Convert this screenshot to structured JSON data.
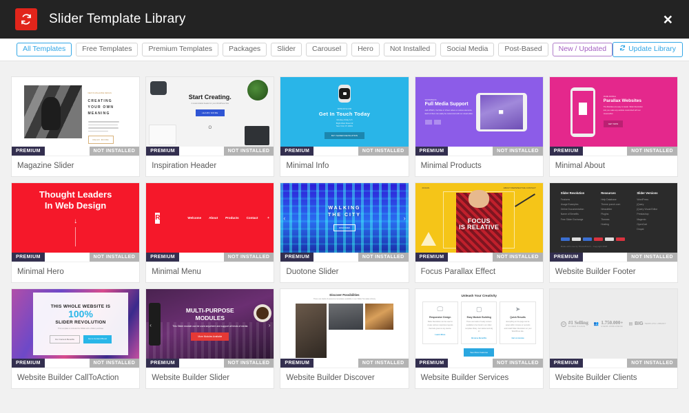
{
  "header": {
    "title": "Slider Template Library",
    "logo_icon": "refresh-icon",
    "close_icon": "×"
  },
  "filters": {
    "chips": [
      {
        "label": "All Templates",
        "state": "active"
      },
      {
        "label": "Free Templates",
        "state": "default"
      },
      {
        "label": "Premium Templates",
        "state": "default"
      },
      {
        "label": "Packages",
        "state": "default"
      },
      {
        "label": "Slider",
        "state": "default"
      },
      {
        "label": "Carousel",
        "state": "default"
      },
      {
        "label": "Hero",
        "state": "default"
      },
      {
        "label": "Not Installed",
        "state": "default"
      },
      {
        "label": "Social Media",
        "state": "default"
      },
      {
        "label": "Post-Based",
        "state": "default"
      },
      {
        "label": "New / Updated",
        "state": "new"
      }
    ],
    "update_button": {
      "label": "Update Library",
      "icon": "refresh-icon"
    }
  },
  "badges": {
    "premium": "PREMIUM",
    "not_installed": "NOT INSTALLED"
  },
  "cards": [
    {
      "title": "Magazine Slider",
      "badge_left": "PREMIUM",
      "badge_right": "NOT INSTALLED",
      "art": {
        "kicker": "NEW IN MAGAZINE DESIGN",
        "heading": "CREATING\nYOUR OWN\nMEANING",
        "button": "READ MORE"
      }
    },
    {
      "title": "Inspiration Header",
      "badge_left": "PREMIUM",
      "badge_right": "NOT INSTALLED",
      "art": {
        "heading": "Start Creating.",
        "sub": "A customizable header for your WordPress Site",
        "button": "LEARN MORE",
        "mark": "O"
      }
    },
    {
      "title": "Minimal Info",
      "badge_left": "PREMIUM",
      "badge_right": "NOT INSTALLED",
      "art": {
        "kicker": "WWW.SITE.COM",
        "heading": "Get In Touch Today",
        "sub": "Monday–Friday 9–5\nBright West Street 42\nNew York, NY 10001",
        "button": "BUY SLIDER REVOLUTION"
      }
    },
    {
      "title": "Minimal Products",
      "badge_left": "PREMIUM",
      "badge_right": "NOT INSTALLED",
      "art": {
        "kicker": "WORDPRESS",
        "heading": "Full Media Support",
        "sub": "Add HTML5, YouTube or Vimeo videos or various elements. Each of them can easily be customized with our visual editor.",
        "button": ""
      }
    },
    {
      "title": "Minimal About",
      "badge_left": "PREMIUM",
      "badge_right": "NOT INSTALLED",
      "art": {
        "kicker": "MADE MOBILE",
        "heading": "Parallax Websites",
        "sub": "The Modules are easy to tweak. Slider Revolution lets you make any website customized with our visual editor.",
        "button": "GET NOW"
      }
    },
    {
      "title": "Minimal Hero",
      "badge_left": "PREMIUM",
      "badge_right": "NOT INSTALLED",
      "art": {
        "heading": "Thought Leaders\nIn Web Design",
        "arrow": "↓"
      }
    },
    {
      "title": "Minimal Menu",
      "badge_left": "PREMIUM",
      "badge_right": "NOT INSTALLED",
      "art": {
        "logo": "R",
        "nav": [
          "Welcome",
          "About",
          "Products",
          "Contact"
        ],
        "social": [
          "twitter-icon",
          "facebook-icon",
          "instagram-icon"
        ]
      }
    },
    {
      "title": "Duotone Slider",
      "badge_left": "PREMIUM",
      "badge_right": "NOT INSTALLED",
      "art": {
        "heading": "WALKING\nTHE CITY",
        "button": "DISCOVER"
      }
    },
    {
      "title": "Focus Parallax Effect",
      "badge_left": "PREMIUM",
      "badge_right": "NOT INSTALLED",
      "art": {
        "brand": "FOCUS",
        "nav": "ABOUT  PERSPECTIVE  CONTACT",
        "nav_button": "SEE MORE",
        "heading": "FOCUS\nIS RELATIVE",
        "sub": "CHANGE YOUR PERSPECTIVE"
      }
    },
    {
      "title": "Website Builder Footer",
      "badge_left": "PREMIUM",
      "badge_right": "NOT INSTALLED",
      "art": {
        "columns": [
          {
            "heading": "Slider Revolution",
            "items": [
              "Features",
              "Usage Examples",
              "Online Documentation",
              "Name of Benefits",
              "Free Slider Exchange"
            ]
          },
          {
            "heading": "Resources",
            "items": [
              "Help Database",
              "Theme punch.com",
              "Newsletter",
              "Plugins",
              "Themes",
              "Hosting"
            ]
          },
          {
            "heading": "Slider Versions",
            "items": [
              "WordPress",
              "jQuery",
              "jQuery Visual Editor",
              "Prestashop",
              "Magento",
              "OpenCart",
              "Drupal"
            ]
          }
        ],
        "copyright": "Made with Love by ThemePunch – Copyright 2018"
      }
    },
    {
      "title": "Website Builder CallToAction",
      "badge_left": "PREMIUM",
      "badge_right": "NOT INSTALLED",
      "art": {
        "line1": "THIS WHOLE WEBSITE IS",
        "line2": "100%",
        "line3": "SLIDER REVOLUTION",
        "sub": "This template is included for FREE with a Slider purchase",
        "button_outline": "Our Content Benefits",
        "button_filled": "Get a Content Boost"
      }
    },
    {
      "title": "Website Builder Slider",
      "badge_left": "PREMIUM",
      "badge_right": "NOT INSTALLED",
      "art": {
        "heading": "MULTI-PURPOSE\nMODULES",
        "sub": "This Slider module can be used anywhere and support all kinds of media",
        "button": "More Modules Available"
      }
    },
    {
      "title": "Website Builder Discover",
      "badge_left": "PREMIUM",
      "badge_right": "NOT INSTALLED",
      "art": {
        "heading": "Discover Possibilities",
        "sub": "There are loads of awesome templates available in our Slider Template Library"
      }
    },
    {
      "title": "Website Builder Services",
      "badge_left": "PREMIUM",
      "badge_right": "NOT INSTALLED",
      "art": {
        "heading": "Unleash Your Creativity",
        "boxes": [
          {
            "icon": "monitor-icon",
            "title": "Responsive Design",
            "desc": "Slider Revolution can be used to create various responsive layouts that look great on any device.",
            "link": "Learn More"
          },
          {
            "icon": "window-icon",
            "title": "Easy Module Building",
            "desc": "There are loads of ready content available to be found in our slider template library. Get started and dig in!",
            "link": "Browse Benefits"
          },
          {
            "icon": "send-icon",
            "title": "Quick Results",
            "desc": "Everything on the page can be setup within minutes or seconds and install Slider Revolution on your WordPress site.",
            "link": "Get a Licence"
          }
        ],
        "button": "See More Features"
      }
    },
    {
      "title": "Website Builder Clients",
      "badge_left": "PREMIUM",
      "badge_right": "NOT INSTALLED",
      "art": {
        "items": [
          {
            "icon": "wordpress-icon",
            "big": "#1 Selling",
            "small": "SLIDER PLUGIN"
          },
          {
            "icon": "users-icon",
            "big": "1.750.000+",
            "small": "USERS WORLDWIDE"
          },
          {
            "icon": "library-icon",
            "big": "BIG",
            "small": "TEMPLATE LIBRARY"
          }
        ]
      }
    }
  ],
  "colors": {
    "brand_red": "#e1251b",
    "accent_blue": "#30a6e6",
    "accent_purple": "#a45ec2",
    "premium_badge": "#332f4f",
    "notinstalled_badge": "#b3b3b3",
    "topbar": "#232323",
    "page_bg": "#f1f1f1"
  }
}
